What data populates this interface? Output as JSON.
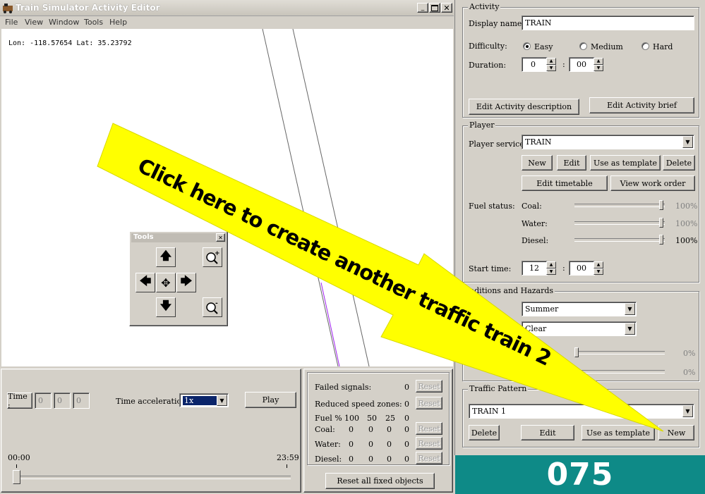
{
  "window": {
    "title": "Train Simulator Activity Editor",
    "menu": [
      "File",
      "View",
      "Window",
      "Tools",
      "Help"
    ]
  },
  "map": {
    "coords": "Lon: -118.57654 Lat: 35.23792"
  },
  "tools_palette": {
    "title": "Tools"
  },
  "time_panel": {
    "time_button": "Time :",
    "hh": "0",
    "mm": "0",
    "ss": "0",
    "acceleration_label": "Time acceleration",
    "acceleration_value": "1x",
    "play_button": "Play",
    "start_time": "00:00",
    "end_time": "23:59"
  },
  "fixed_panel": {
    "failed_signals_label": "Failed signals:",
    "failed_signals_value": "0",
    "reduced_speed_label": "Reduced speed zones:",
    "reduced_speed_value": "0",
    "fuel_header": [
      "Fuel %",
      "100",
      "50",
      "25",
      "0"
    ],
    "rows": [
      {
        "label": "Coal:",
        "values": [
          "0",
          "0",
          "0",
          "0"
        ]
      },
      {
        "label": "Water:",
        "values": [
          "0",
          "0",
          "0",
          "0"
        ]
      },
      {
        "label": "Diesel:",
        "values": [
          "0",
          "0",
          "0",
          "0"
        ]
      }
    ],
    "reset_label": "Reset",
    "reset_all_button": "Reset all fixed objects"
  },
  "activity": {
    "group_title": "Activity",
    "display_name_label": "Display name:",
    "display_name_value": "TRAIN",
    "difficulty_label": "Difficulty:",
    "difficulty_options": [
      "Easy",
      "Medium",
      "Hard"
    ],
    "difficulty_selected": "Easy",
    "duration_label": "Duration:",
    "duration_hours": "0",
    "duration_minutes": "00",
    "edit_description_button": "Edit Activity description",
    "edit_brief_button": "Edit Activity brief"
  },
  "player": {
    "group_title": "Player",
    "service_label": "Player service:",
    "service_value": "TRAIN",
    "new_button": "New",
    "edit_button": "Edit",
    "template_button": "Use as template",
    "delete_button": "Delete",
    "edit_timetable_button": "Edit timetable",
    "view_work_order_button": "View work order",
    "fuel_status_label": "Fuel status:",
    "fuel": [
      {
        "label": "Coal:",
        "value": "100%",
        "level": 1.0
      },
      {
        "label": "Water:",
        "value": "100%",
        "level": 1.0
      },
      {
        "label": "Diesel:",
        "value": "100%",
        "level": 1.0
      }
    ],
    "start_time_label": "Start time:",
    "start_hours": "12",
    "start_minutes": "00"
  },
  "conditions": {
    "group_title": "nditions and Hazards",
    "season_value": "Summer",
    "weather_value": "Clear",
    "slider1_value": "0%",
    "slider2_value": "0%"
  },
  "traffic": {
    "group_title": "Traffic Pattern",
    "pattern_value": "TRAIN 1",
    "delete_button": "Delete",
    "edit_button": "Edit",
    "template_button": "Use as template",
    "new_button": "New"
  },
  "overlay": {
    "callout_text": "Click here to create another traffic train 2",
    "slide_number": "075"
  },
  "colors": {
    "dialog_bg": "#d4d0c8",
    "title_bar": "#d4d0c8",
    "selection": "#0a246a",
    "callout": "#ffff00",
    "slide_badge": "#0e8a87",
    "track_purple": "#a020f0"
  }
}
